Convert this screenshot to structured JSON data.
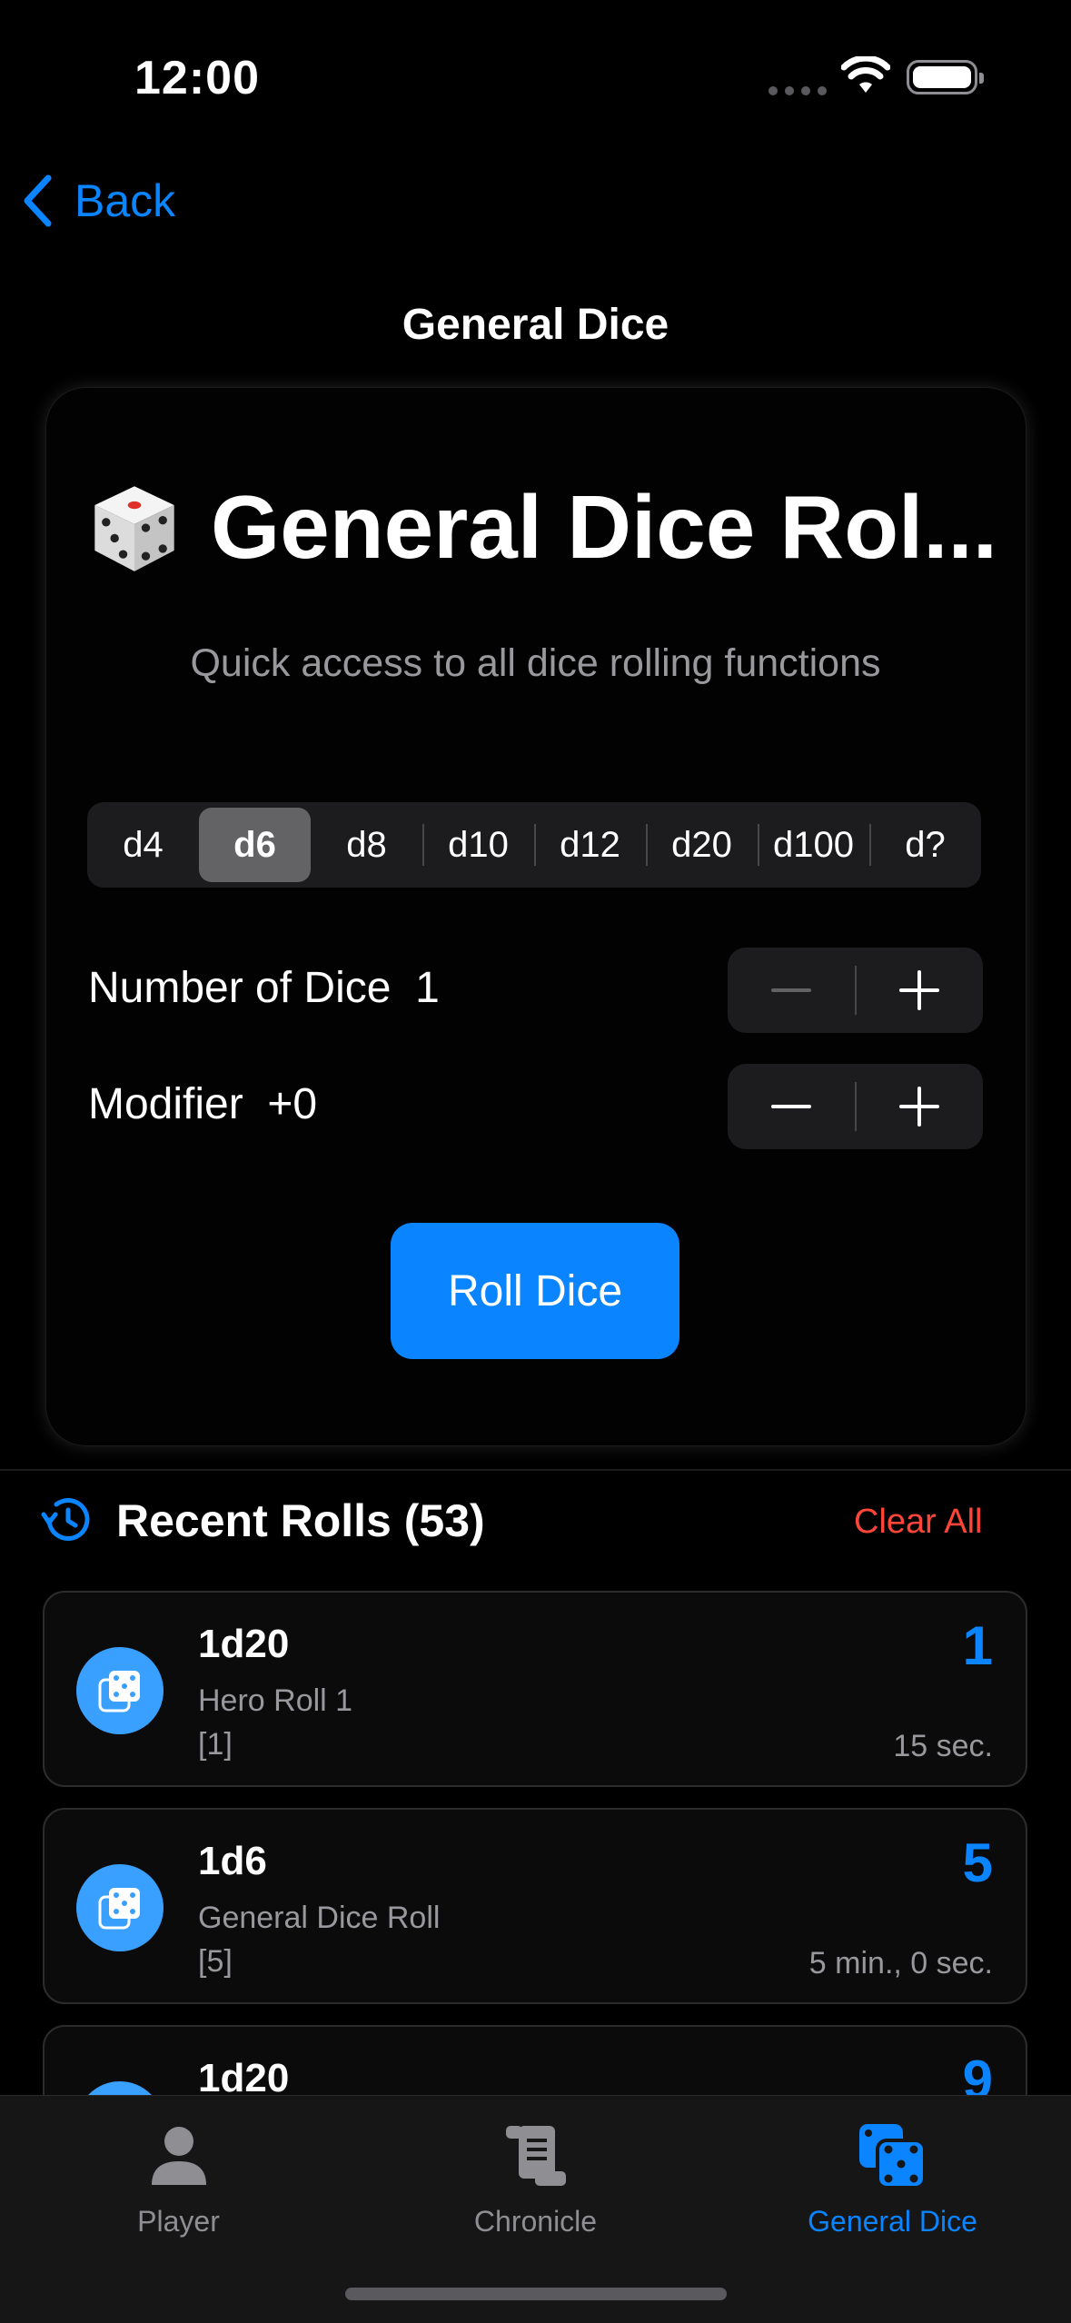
{
  "status_bar": {
    "time": "12:00"
  },
  "nav": {
    "back_label": "Back",
    "title": "General Dice"
  },
  "card": {
    "title": "General Dice Rol...",
    "subtitle": "Quick access to all dice rolling functions",
    "dice_types": [
      "d4",
      "d6",
      "d8",
      "d10",
      "d12",
      "d20",
      "d100",
      "d?"
    ],
    "selected_die": "d6",
    "number_of_dice_label": "Number of Dice",
    "number_of_dice_value": "1",
    "modifier_label": "Modifier",
    "modifier_value": "+0",
    "roll_button": "Roll Dice"
  },
  "recent": {
    "title": "Recent Rolls (53)",
    "clear_all": "Clear All",
    "rolls": [
      {
        "expr": "1d20",
        "name": "Hero Roll 1",
        "detail": "[1]",
        "result": "1",
        "time": "15 sec."
      },
      {
        "expr": "1d6",
        "name": "General Dice Roll",
        "detail": "[5]",
        "result": "5",
        "time": "5 min., 0 sec."
      },
      {
        "expr": "1d20",
        "name": "",
        "detail": "",
        "result": "9",
        "time": ""
      }
    ]
  },
  "tabs": [
    {
      "label": "Player",
      "icon": "person-icon"
    },
    {
      "label": "Chronicle",
      "icon": "scroll-icon"
    },
    {
      "label": "General Dice",
      "icon": "dice-icon",
      "active": true
    }
  ],
  "colors": {
    "accent": "#0a84ff",
    "destructive": "#ff453a",
    "background": "#000000"
  }
}
